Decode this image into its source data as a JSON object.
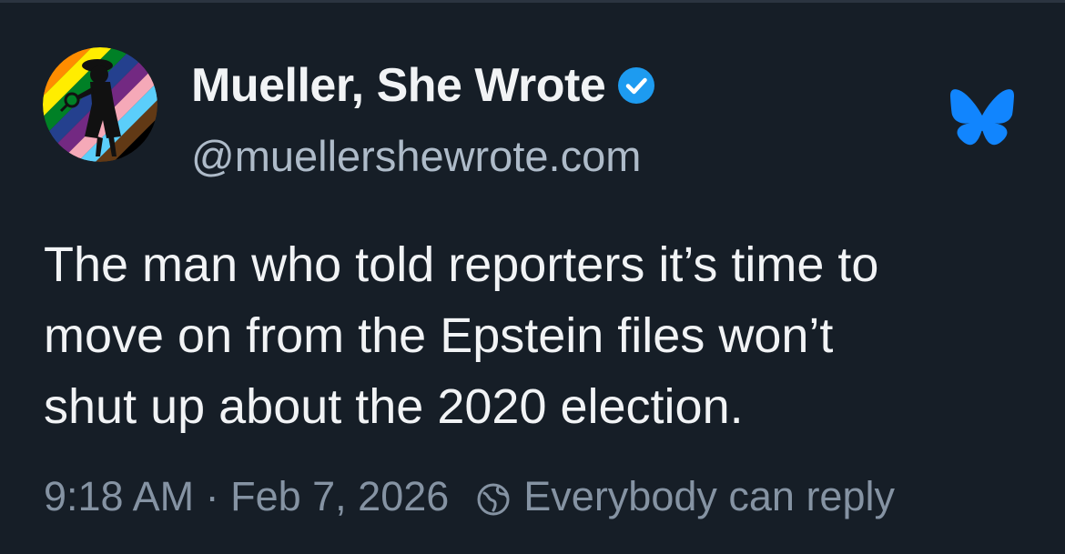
{
  "author": {
    "display_name": "Mueller, She Wrote",
    "handle": "@muellershewrote.com",
    "avatar_icon": "rainbow-detective-avatar",
    "verified_icon": "verified-check-icon",
    "verified_color": "#1d9bf0"
  },
  "post": {
    "lines": [
      "The man who told reporters it’s time to",
      "move on from the Epstein files won’t",
      "shut up about the 2020 election."
    ]
  },
  "meta": {
    "timestamp": "9:18 AM · Feb 7, 2026",
    "reply_setting": "Everybody can reply",
    "reply_icon": "globe-icon"
  },
  "app": {
    "logo_icon": "bluesky-butterfly-icon",
    "brand_color": "#1185fe"
  },
  "colors": {
    "background": "#161e27",
    "text_primary": "#f1f3f5",
    "text_secondary": "#aebbc9",
    "text_meta": "#8593a3"
  }
}
